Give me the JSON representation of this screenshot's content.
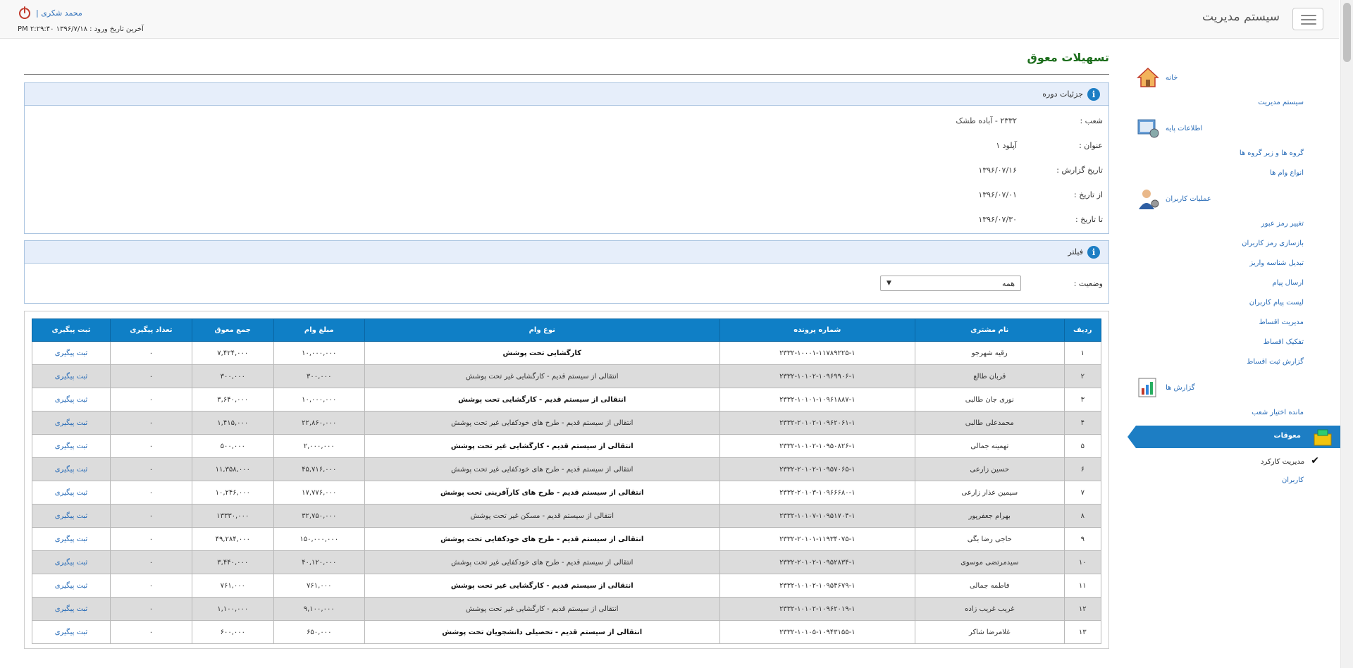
{
  "header": {
    "brand": "سیستم مدیریت",
    "username": "محمد شکری |",
    "last_login": "آخرین تاریخ ورود : ۱۳۹۶/۷/۱۸ ۲:۲۹:۴۰ PM"
  },
  "sidebar": {
    "home": "خانه",
    "system_management": "سیستم مدیریت",
    "basic_info": "اطلاعات پایه",
    "groups": "گروه ها و زیر گروه ها",
    "loan_types": "انواع وام ها",
    "user_operations": "عملیات کاربران",
    "change_password": "تغییر رمز عبور",
    "reset_passwords": "بازسازی رمز کاربران",
    "convert_deposit": "تبدیل شناسه واریز",
    "send_message": "ارسال پیام",
    "user_message_list": "لیست پیام کاربران",
    "installments_management": "مدیریت اقساط",
    "installments_split": "تفکیک اقساط",
    "installments_report": "گزارش ثبت اقساط",
    "reports": "گزارش ها",
    "branch_balance": "مانده اختیار شعب",
    "overdue": "معوقات",
    "performance_management": "مدیریت کارکرد",
    "users": "کاربران"
  },
  "page": {
    "title": "تسهیلات معوق",
    "details_title": "جزئیات دوره",
    "details": [
      {
        "label": "شعب :",
        "value": "۲۳۳۲ - آباده طشک"
      },
      {
        "label": "عنوان :",
        "value": "آپلود ۱"
      },
      {
        "label": "تاریخ گزارش :",
        "value": "۱۳۹۶/۰۷/۱۶"
      },
      {
        "label": "از تاریخ :",
        "value": "۱۳۹۶/۰۷/۰۱"
      },
      {
        "label": "تا تاریخ :",
        "value": "۱۳۹۶/۰۷/۳۰"
      }
    ],
    "filter_title": "فیلتر",
    "status_label": "وضعیت :",
    "status_value": "همه"
  },
  "table": {
    "headers": [
      "ردیف",
      "نام مشتری",
      "شماره پرونده",
      "نوع وام",
      "مبلغ وام",
      "جمع معوق",
      "تعداد پیگیری",
      "ثبت پیگیری"
    ],
    "rows": [
      [
        "۱",
        "رقیه شهرجو",
        "۲۳۳۲-۱۰۰۰۱-۱۱۷۸۹۲۲۵-۱",
        "کارگشایی تحت پوشش",
        "۱۰,۰۰۰,۰۰۰",
        "۷,۴۲۴,۰۰۰",
        "۰",
        "ثبت پیگیری"
      ],
      [
        "۲",
        "قربان طالع",
        "۲۳۳۲-۱۰۱۰۲-۱۰۹۶۹۹۰۶-۱",
        "انتقالی از سیستم قدیم - کارگشایی غیر تحت پوشش",
        "۳۰۰,۰۰۰",
        "۳۰۰,۰۰۰",
        "۰",
        "ثبت پیگیری"
      ],
      [
        "۳",
        "نوری جان طالبی",
        "۲۳۳۲-۱۰۱۰۱-۱۰۹۶۱۸۸۷-۱",
        "انتقالی از سیستم قدیم - کارگشایی تحت پوشش",
        "۱۰,۰۰۰,۰۰۰",
        "۳,۶۴۰,۰۰۰",
        "۰",
        "ثبت پیگیری"
      ],
      [
        "۴",
        "محمدعلی طالبی",
        "۲۳۳۲-۲۰۱۰۲-۱۰۹۶۲۰۶۱-۱",
        "انتقالی از سیستم قدیم - طرح های خودکفایی غیر تحت پوشش",
        "۲۲,۸۶۰,۰۰۰",
        "۱,۴۱۵,۰۰۰",
        "۰",
        "ثبت پیگیری"
      ],
      [
        "۵",
        "تهمینه جمالی",
        "۲۳۳۲-۱۰۱۰۲-۱۰۹۵۰۸۲۶-۱",
        "انتقالی از سیستم قدیم - کارگشایی غیر تحت پوشش",
        "۲,۰۰۰,۰۰۰",
        "۵۰۰,۰۰۰",
        "۰",
        "ثبت پیگیری"
      ],
      [
        "۶",
        "حسین زارعی",
        "۲۳۳۲-۲۰۱۰۲-۱۰۹۵۷۰۶۵-۱",
        "انتقالی از سیستم قدیم - طرح های خودکفایی غیر تحت پوشش",
        "۴۵,۷۱۶,۰۰۰",
        "۱۱,۳۵۸,۰۰۰",
        "۰",
        "ثبت پیگیری"
      ],
      [
        "۷",
        "سیمین عذار زارعی",
        "۲۳۳۲-۲۰۱۰۳-۱۰۹۶۶۶۸۰-۱",
        "انتقالی از سیستم قدیم - طرح های کارآفرینی تحت پوشش",
        "۱۷,۷۷۶,۰۰۰",
        "۱۰,۲۴۶,۰۰۰",
        "۰",
        "ثبت پیگیری"
      ],
      [
        "۸",
        "بهرام جعفرپور",
        "۲۳۳۲-۱۰۱۰۷-۱۰۹۵۱۷۰۴-۱",
        "انتقالی از سیستم قدیم - مسکن غیر تحت پوشش",
        "۳۲,۷۵۰,۰۰۰",
        "۱۳۳۳۰,۰۰۰",
        "۰",
        "ثبت پیگیری"
      ],
      [
        "۹",
        "حاجی رضا بگی",
        "۲۳۳۲-۲۰۱۰۱-۱۱۹۳۴۰۷۵-۱",
        "انتقالی از سیستم قدیم - طرح های خودکفایی تحت پوشش",
        "۱۵۰,۰۰۰,۰۰۰",
        "۴۹,۲۸۴,۰۰۰",
        "۰",
        "ثبت پیگیری"
      ],
      [
        "۱۰",
        "سیدمرتضی موسوی",
        "۲۳۳۲-۲۰۱۰۲-۱۰۹۵۲۸۳۴-۱",
        "انتقالی از سیستم قدیم - طرح های خودکفایی غیر تحت پوشش",
        "۴۰,۱۲۰,۰۰۰",
        "۳,۴۴۰,۰۰۰",
        "۰",
        "ثبت پیگیری"
      ],
      [
        "۱۱",
        "فاطمه جمالی",
        "۲۳۳۲-۱۰۱۰۲-۱۰۹۵۴۶۷۹-۱",
        "انتقالی از سیستم قدیم - کارگشایی غیر تحت پوشش",
        "۷۶۱,۰۰۰",
        "۷۶۱,۰۰۰",
        "۰",
        "ثبت پیگیری"
      ],
      [
        "۱۲",
        "غریب غریب زاده",
        "۲۳۳۲-۱۰۱۰۲-۱۰۹۶۲۰۱۹-۱",
        "انتقالی از سیستم قدیم - کارگشایی غیر تحت پوشش",
        "۹,۱۰۰,۰۰۰",
        "۱,۱۰۰,۰۰۰",
        "۰",
        "ثبت پیگیری"
      ],
      [
        "۱۳",
        "غلامرضا شاکر",
        "۲۳۳۲-۱۰۱۰۵-۱۰۹۴۳۱۵۵-۱",
        "انتقالی از سیستم قدیم - تحصیلی دانشجویان تحت پوشش",
        "۶۵۰,۰۰۰",
        "۶۰۰,۰۰۰",
        "۰",
        "ثبت پیگیری"
      ]
    ]
  }
}
